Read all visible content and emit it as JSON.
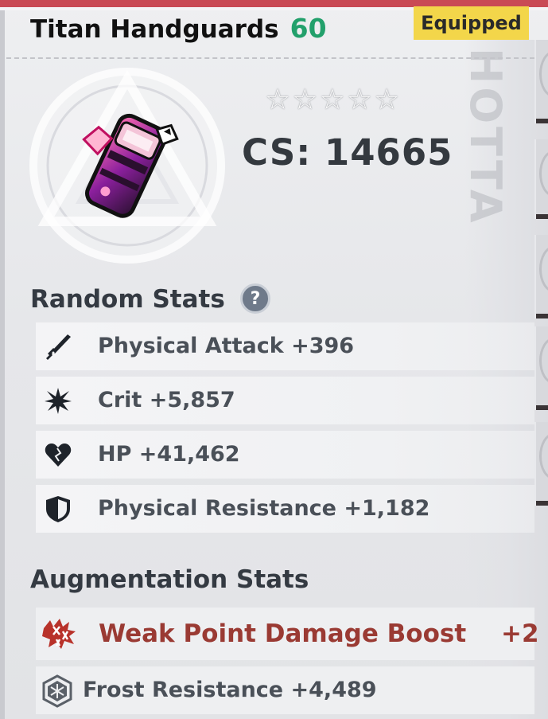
{
  "header": {
    "item_name": "Titan Handguards",
    "level": "60",
    "status_badge": "Equipped"
  },
  "item": {
    "stars": [
      "☆",
      "☆",
      "☆",
      "☆",
      "☆"
    ],
    "cs": "CS: 14665"
  },
  "random_stats": {
    "title": "Random Stats",
    "help": "?",
    "items": [
      {
        "icon": "sword-icon",
        "label": "Physical Attack +396"
      },
      {
        "icon": "burst-icon",
        "label": "Crit +5,857"
      },
      {
        "icon": "heart-icon",
        "label": "HP +41,462"
      },
      {
        "icon": "shield-icon",
        "label": "Physical Resistance +1,182"
      }
    ]
  },
  "augmentation_stats": {
    "title": "Augmentation Stats",
    "items": [
      {
        "icon": "weak-point-icon",
        "label": "Weak Point Damage Boost",
        "value": "+2",
        "color": "#9a3a33"
      },
      {
        "icon": "frost-icon",
        "label": "Frost Resistance +4,489",
        "color": "#4a5058"
      }
    ]
  },
  "colors": {
    "level": "#22a06b",
    "badge": "#f3d64a",
    "accent_bar": "#c94a55"
  }
}
